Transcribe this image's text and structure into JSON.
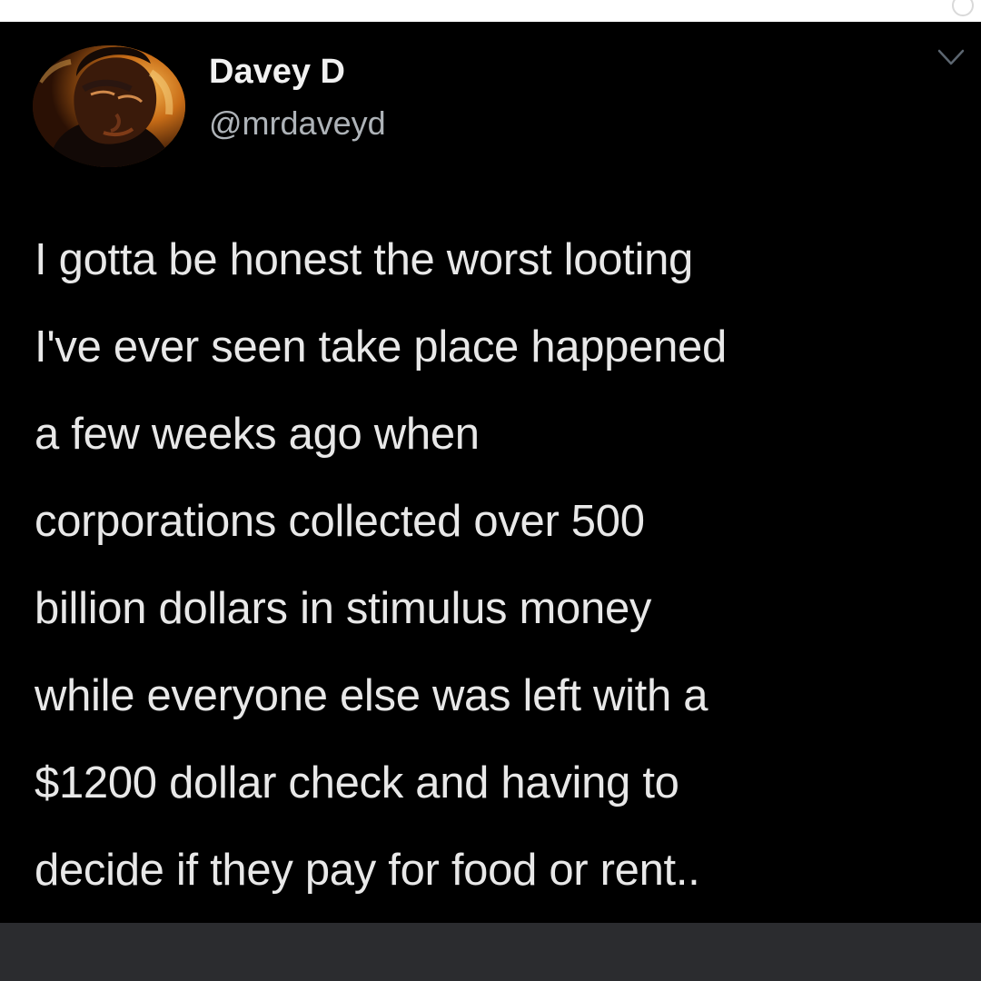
{
  "tweet": {
    "author": {
      "display_name": "Davey D",
      "handle": "@mrdaveyd"
    },
    "icons": {
      "menu": "chevron-down-icon",
      "avatar": "profile-photo"
    },
    "text_lines": [
      "I gotta be honest the worst looting",
      "I've ever seen take place happened",
      "a few weeks ago when",
      "corporations collected over 500",
      "billion dollars in stimulus money",
      "while everyone else was left with a",
      "$1200 dollar check and having to",
      "decide if they pay for food or rent.."
    ]
  },
  "colors": {
    "tweet_background": "#000000",
    "display_name": "#f1f1f1",
    "handle": "#aeb3b8",
    "text": "#e8e8e8",
    "bottom_bar": "#2b2c2f"
  }
}
